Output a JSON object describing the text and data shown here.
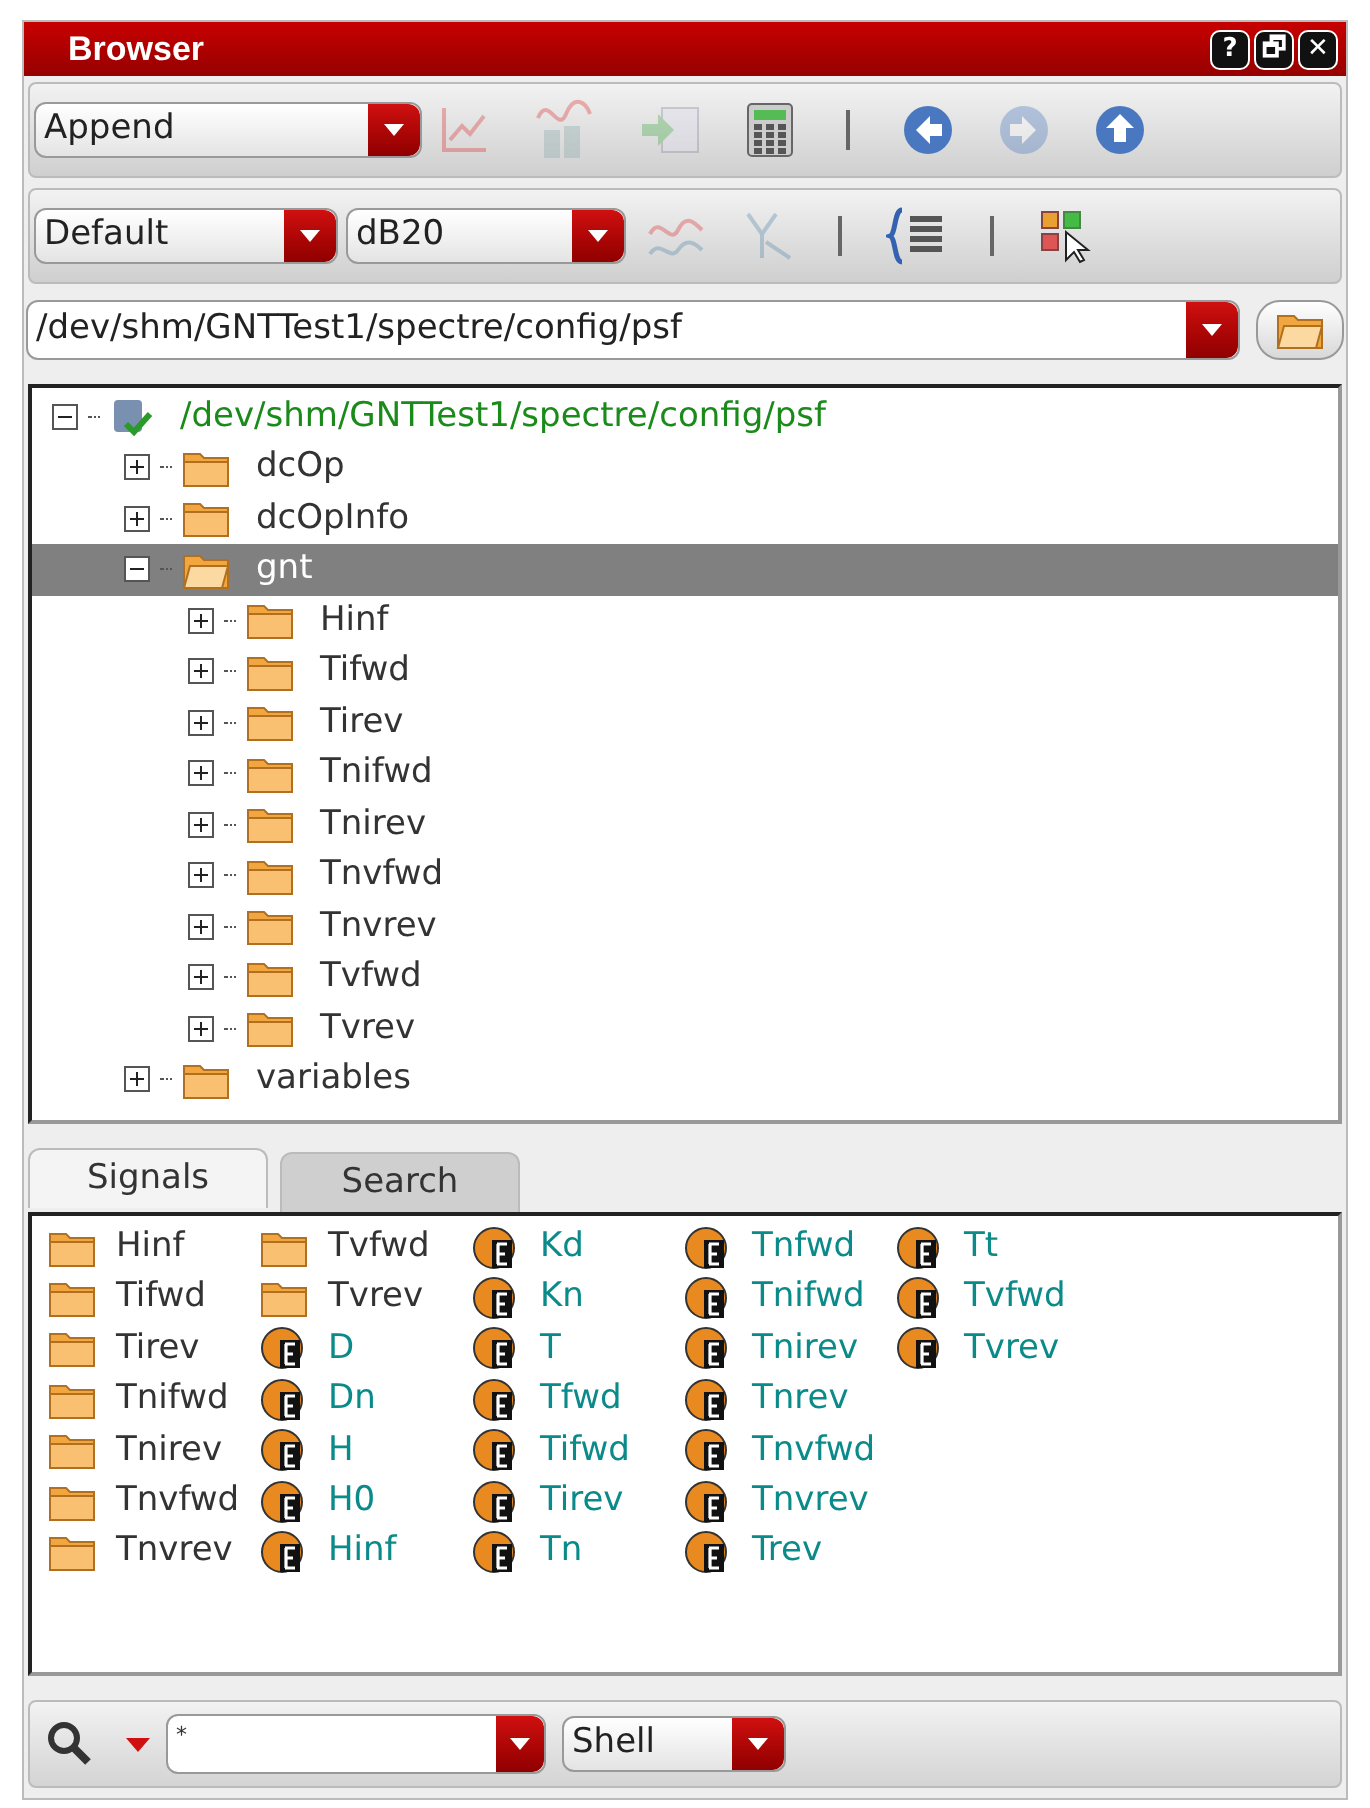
{
  "window": {
    "title": "Browser",
    "controls": [
      "?",
      "🗗",
      "✕"
    ]
  },
  "toolbar1": {
    "mode": "Append",
    "tools": [
      {
        "kind": "line-chart",
        "disabled": true
      },
      {
        "kind": "wave-overlay",
        "disabled": true
      },
      {
        "kind": "import-table",
        "disabled": true
      },
      {
        "kind": "calculator",
        "disabled": false
      },
      {
        "kind": "separator",
        "disabled": false
      },
      {
        "kind": "back",
        "disabled": false
      },
      {
        "kind": "forward",
        "disabled": true
      },
      {
        "kind": "up",
        "disabled": false
      }
    ]
  },
  "toolbar2": {
    "style": "Default",
    "scale": "dB20",
    "tools": [
      {
        "kind": "waves",
        "disabled": true
      },
      {
        "kind": "y-axis",
        "disabled": true
      },
      {
        "kind": "separator",
        "disabled": false
      },
      {
        "kind": "brace-list",
        "disabled": false
      },
      {
        "kind": "separator",
        "disabled": false
      },
      {
        "kind": "select-grid",
        "disabled": false
      }
    ]
  },
  "path": "/dev/shm/GNTTest1/spectre/config/psf",
  "tree": {
    "label": "/dev/shm/GNTTest1/spectre/config/psf",
    "expanded": true,
    "children": [
      {
        "label": "dcOp",
        "expanded": false,
        "selected": false
      },
      {
        "label": "dcOpInfo",
        "expanded": false,
        "selected": false
      },
      {
        "label": "gnt",
        "expanded": true,
        "selected": true,
        "children": [
          {
            "label": "Hinf",
            "expanded": false,
            "selected": false
          },
          {
            "label": "Tifwd",
            "expanded": false,
            "selected": false
          },
          {
            "label": "Tirev",
            "expanded": false,
            "selected": false
          },
          {
            "label": "Tnifwd",
            "expanded": false,
            "selected": false
          },
          {
            "label": "Tnirev",
            "expanded": false,
            "selected": false
          },
          {
            "label": "Tnvfwd",
            "expanded": false,
            "selected": false
          },
          {
            "label": "Tnvrev",
            "expanded": false,
            "selected": false
          },
          {
            "label": "Tvfwd",
            "expanded": false,
            "selected": false
          },
          {
            "label": "Tvrev",
            "expanded": false,
            "selected": false
          }
        ]
      },
      {
        "label": "variables",
        "expanded": false,
        "selected": false
      }
    ]
  },
  "tabs": [
    {
      "label": "Signals",
      "selected": true
    },
    {
      "label": "Search",
      "selected": false
    }
  ],
  "signals": [
    {
      "kind": "folder",
      "label": "Hinf"
    },
    {
      "kind": "folder",
      "label": "Tifwd"
    },
    {
      "kind": "folder",
      "label": "Tirev"
    },
    {
      "kind": "folder",
      "label": "Tnifwd"
    },
    {
      "kind": "folder",
      "label": "Tnirev"
    },
    {
      "kind": "folder",
      "label": "Tnvfwd"
    },
    {
      "kind": "folder",
      "label": "Tnvrev"
    },
    {
      "kind": "folder",
      "label": "Tvfwd"
    },
    {
      "kind": "folder",
      "label": "Tvrev"
    },
    {
      "kind": "signal",
      "label": "D"
    },
    {
      "kind": "signal",
      "label": "Dn"
    },
    {
      "kind": "signal",
      "label": "H"
    },
    {
      "kind": "signal",
      "label": "H0"
    },
    {
      "kind": "signal",
      "label": "Hinf"
    },
    {
      "kind": "signal",
      "label": "Kd"
    },
    {
      "kind": "signal",
      "label": "Kn"
    },
    {
      "kind": "signal",
      "label": "T"
    },
    {
      "kind": "signal",
      "label": "Tfwd"
    },
    {
      "kind": "signal",
      "label": "Tifwd"
    },
    {
      "kind": "signal",
      "label": "Tirev"
    },
    {
      "kind": "signal",
      "label": "Tn"
    },
    {
      "kind": "signal",
      "label": "Tnfwd"
    },
    {
      "kind": "signal",
      "label": "Tnifwd"
    },
    {
      "kind": "signal",
      "label": "Tnirev"
    },
    {
      "kind": "signal",
      "label": "Tnrev"
    },
    {
      "kind": "signal",
      "label": "Tnvfwd"
    },
    {
      "kind": "signal",
      "label": "Tnvrev"
    },
    {
      "kind": "signal",
      "label": "Trev"
    },
    {
      "kind": "signal",
      "label": "Tt"
    },
    {
      "kind": "signal",
      "label": "Tvfwd"
    },
    {
      "kind": "signal",
      "label": "Tvrev"
    }
  ],
  "filter": {
    "value": "*",
    "mode": "Shell"
  }
}
